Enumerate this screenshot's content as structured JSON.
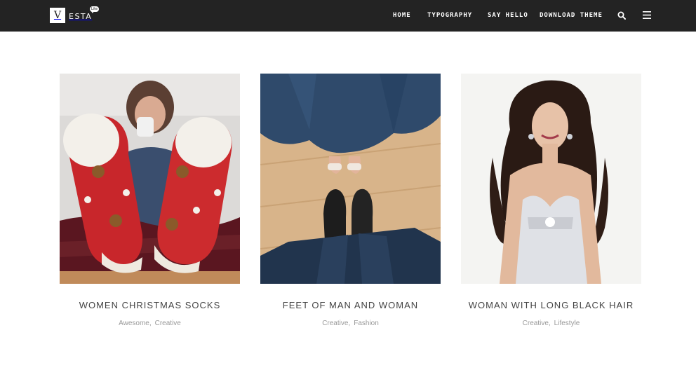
{
  "header": {
    "logo_letter": "V",
    "logo_text": "ESTA",
    "logo_badge": "Lite",
    "nav": [
      "HOME",
      "TYPOGRAPHY",
      "SAY HELLO",
      "DOWNLOAD THEME"
    ],
    "search_icon": "search-icon",
    "menu_icon": "hamburger-menu-icon"
  },
  "cards": [
    {
      "title": "WOMEN CHRISTMAS SOCKS",
      "tags": [
        "Awesome",
        "Creative"
      ],
      "image": "woman-christmas-socks-photo"
    },
    {
      "title": "FEET OF MAN AND WOMAN",
      "tags": [
        "Creative",
        "Fashion"
      ],
      "image": "feet-man-woman-photo"
    },
    {
      "title": "WOMAN WITH LONG BLACK HAIR",
      "tags": [
        "Creative",
        "Lifestyle"
      ],
      "image": "woman-long-hair-photo"
    }
  ],
  "tag_separator": ",",
  "colors": {
    "header_bg": "#232323",
    "text": "#444444",
    "muted": "#999999"
  }
}
